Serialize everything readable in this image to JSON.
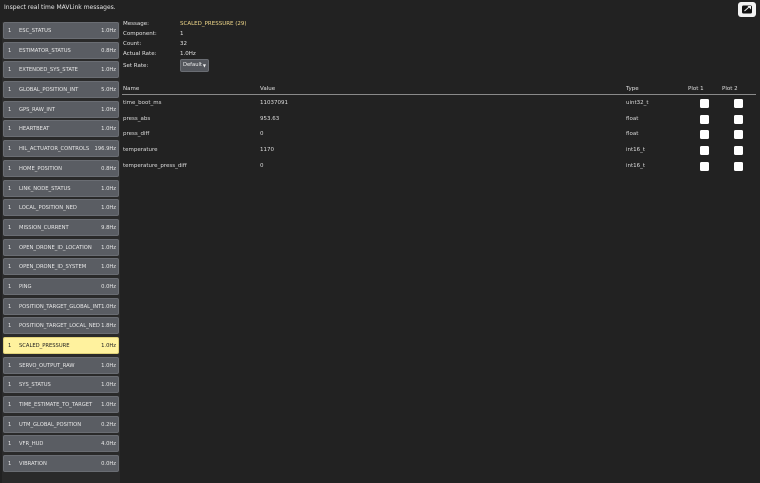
{
  "header": {
    "description": "Inspect real time MAVLink messages.",
    "detach_icon": "detach-icon"
  },
  "messages": [
    {
      "cid": "1",
      "name": "ESC_STATUS",
      "rate": "1.0Hz"
    },
    {
      "cid": "1",
      "name": "ESTIMATOR_STATUS",
      "rate": "0.8Hz"
    },
    {
      "cid": "1",
      "name": "EXTENDED_SYS_STATE",
      "rate": "1.0Hz"
    },
    {
      "cid": "1",
      "name": "GLOBAL_POSITION_INT",
      "rate": "5.0Hz"
    },
    {
      "cid": "1",
      "name": "GPS_RAW_INT",
      "rate": "1.0Hz"
    },
    {
      "cid": "1",
      "name": "HEARTBEAT",
      "rate": "1.0Hz"
    },
    {
      "cid": "1",
      "name": "HIL_ACTUATOR_CONTROLS",
      "rate": "196.9Hz"
    },
    {
      "cid": "1",
      "name": "HOME_POSITION",
      "rate": "0.8Hz"
    },
    {
      "cid": "1",
      "name": "LINK_NODE_STATUS",
      "rate": "1.0Hz"
    },
    {
      "cid": "1",
      "name": "LOCAL_POSITION_NED",
      "rate": "1.0Hz"
    },
    {
      "cid": "1",
      "name": "MISSION_CURRENT",
      "rate": "9.8Hz"
    },
    {
      "cid": "1",
      "name": "OPEN_DRONE_ID_LOCATION",
      "rate": "1.0Hz"
    },
    {
      "cid": "1",
      "name": "OPEN_DRONE_ID_SYSTEM",
      "rate": "1.0Hz"
    },
    {
      "cid": "1",
      "name": "PING",
      "rate": "0.0Hz"
    },
    {
      "cid": "1",
      "name": "POSITION_TARGET_GLOBAL_INT",
      "rate": "1.0Hz"
    },
    {
      "cid": "1",
      "name": "POSITION_TARGET_LOCAL_NED",
      "rate": "1.8Hz"
    },
    {
      "cid": "1",
      "name": "SCALED_PRESSURE",
      "rate": "1.0Hz",
      "selected": true
    },
    {
      "cid": "1",
      "name": "SERVO_OUTPUT_RAW",
      "rate": "1.0Hz"
    },
    {
      "cid": "1",
      "name": "SYS_STATUS",
      "rate": "1.0Hz"
    },
    {
      "cid": "1",
      "name": "TIME_ESTIMATE_TO_TARGET",
      "rate": "1.0Hz"
    },
    {
      "cid": "1",
      "name": "UTM_GLOBAL_POSITION",
      "rate": "0.2Hz"
    },
    {
      "cid": "1",
      "name": "VFR_HUD",
      "rate": "4.0Hz"
    },
    {
      "cid": "1",
      "name": "VIBRATION",
      "rate": "0.0Hz"
    }
  ],
  "info": {
    "message_label": "Message:",
    "message_value": "SCALED_PRESSURE (29)",
    "component_label": "Component:",
    "component_value": "1",
    "count_label": "Count:",
    "count_value": "32",
    "actual_rate_label": "Actual Rate:",
    "actual_rate_value": "1.0Hz",
    "set_rate_label": "Set Rate:",
    "set_rate_value": "Default"
  },
  "table": {
    "headers": {
      "name": "Name",
      "value": "Value",
      "type": "Type",
      "plot1": "Plot 1",
      "plot2": "Plot 2"
    },
    "rows": [
      {
        "name": "time_boot_ms",
        "value": "11037091",
        "type": "uint32_t",
        "plot1": false,
        "plot2": false
      },
      {
        "name": "press_abs",
        "value": "953.63",
        "type": "float",
        "plot1": false,
        "plot2": false
      },
      {
        "name": "press_diff",
        "value": "0",
        "type": "float",
        "plot1": false,
        "plot2": false
      },
      {
        "name": "temperature",
        "value": "1170",
        "type": "int16_t",
        "plot1": false,
        "plot2": false
      },
      {
        "name": "temperature_press_diff",
        "value": "0",
        "type": "int16_t",
        "plot1": false,
        "plot2": false
      }
    ]
  },
  "colors": {
    "background": "#222222",
    "button": "#5a5d63",
    "selected": "#fff29e",
    "message_value": "#f0d88a"
  }
}
